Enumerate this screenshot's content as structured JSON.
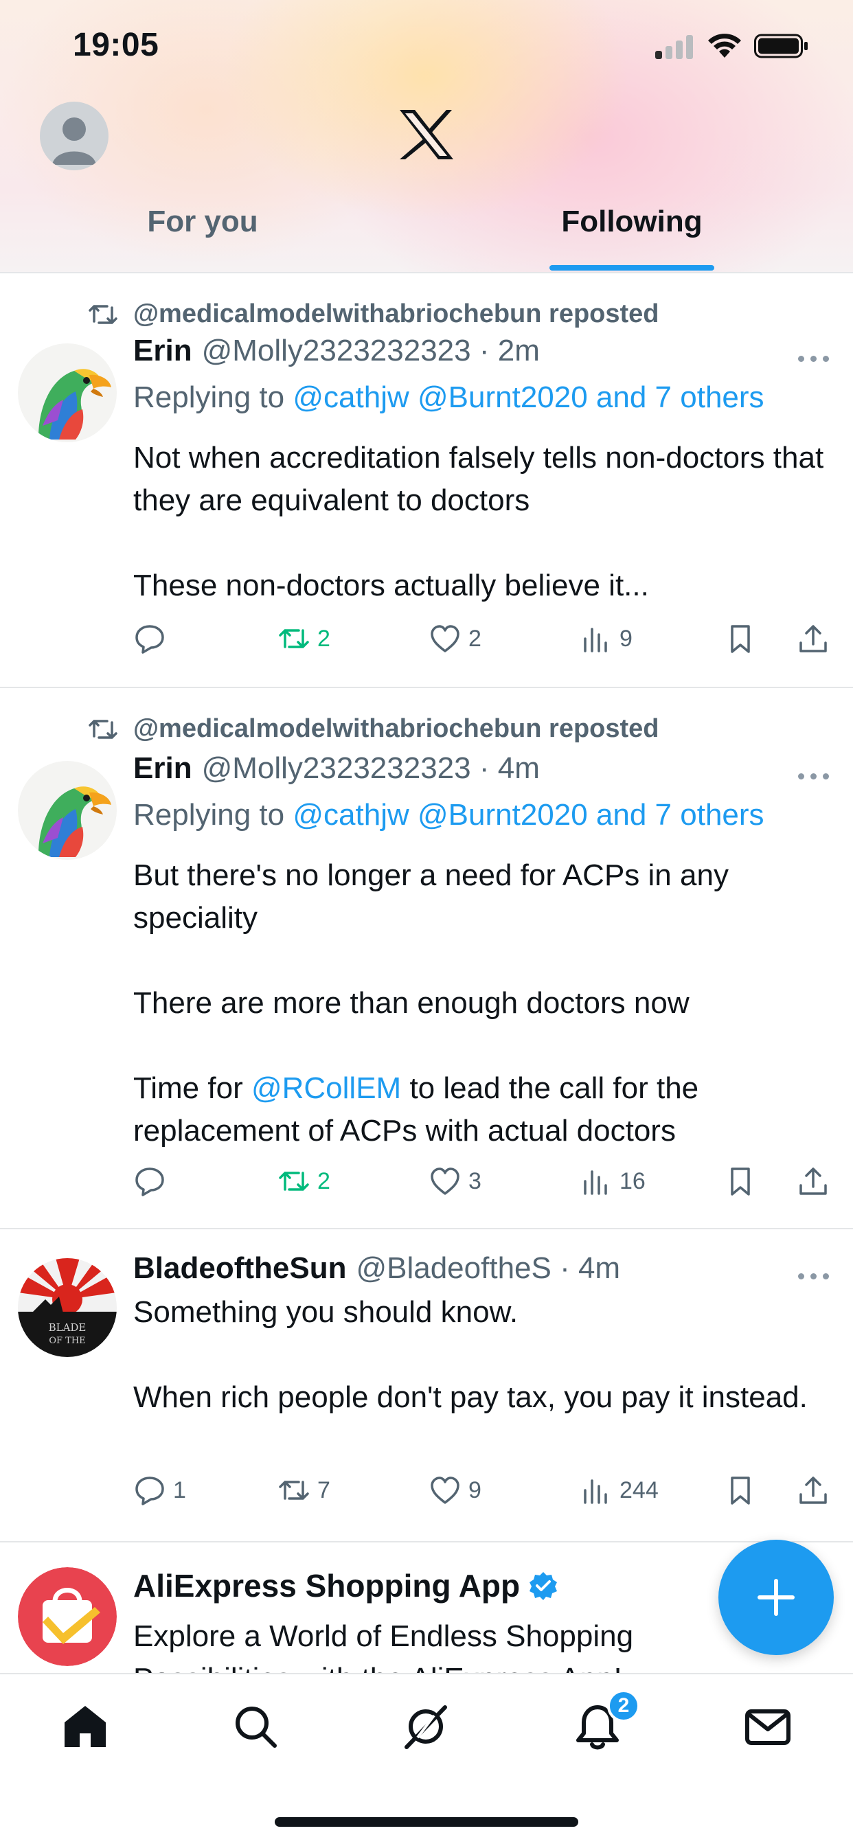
{
  "status_bar": {
    "time": "19:05"
  },
  "header": {
    "tabs": [
      {
        "label": "For you",
        "active": false
      },
      {
        "label": "Following",
        "active": true
      }
    ]
  },
  "tweets": [
    {
      "repost_label": "@medicalmodelwithabriochebun reposted",
      "name": "Erin",
      "handle_time": "@Molly2323232323 · 2m",
      "replying_prefix": "Replying to",
      "replying_to": "@cathjw @Burnt2020 and 7 others",
      "paragraphs": [
        "Not when accreditation falsely tells non-doctors that they are equivalent to doctors",
        "These non-doctors actually believe it..."
      ],
      "counts": {
        "replies": "",
        "reposts": "2",
        "likes": "2",
        "views": "9"
      }
    },
    {
      "repost_label": "@medicalmodelwithabriochebun reposted",
      "name": "Erin",
      "handle_time": "@Molly2323232323 · 4m",
      "replying_prefix": "Replying to",
      "replying_to": "@cathjw @Burnt2020 and 7 others",
      "paragraphs": [
        "But there's no longer a need for ACPs in any speciality",
        "There are more than enough doctors now"
      ],
      "para3_prefix": "Time for",
      "para3_mention": "@RCollEM",
      "para3_suffix": "to lead the call for the replacement of ACPs with actual doctors",
      "counts": {
        "replies": "",
        "reposts": "2",
        "likes": "3",
        "views": "16"
      }
    },
    {
      "name": "BladeoftheSun",
      "handle_time": "@BladeoftheS · 4m",
      "paragraphs": [
        "Something you should know.",
        "When rich people don't pay tax, you pay it instead."
      ],
      "counts": {
        "replies": "1",
        "reposts": "7",
        "likes": "9",
        "views": "244"
      }
    }
  ],
  "ad": {
    "name": "AliExpress Shopping App",
    "text": "Explore a World of Endless Shopping Possibilities with the AliExpress App!"
  },
  "bottom_nav": {
    "items": [
      "home",
      "search",
      "grok",
      "notifications",
      "messages"
    ],
    "notification_badge": "2"
  },
  "colors": {
    "accent": "#1d9bf0",
    "repost_green": "#00ba7c",
    "secondary_text": "#536471"
  }
}
